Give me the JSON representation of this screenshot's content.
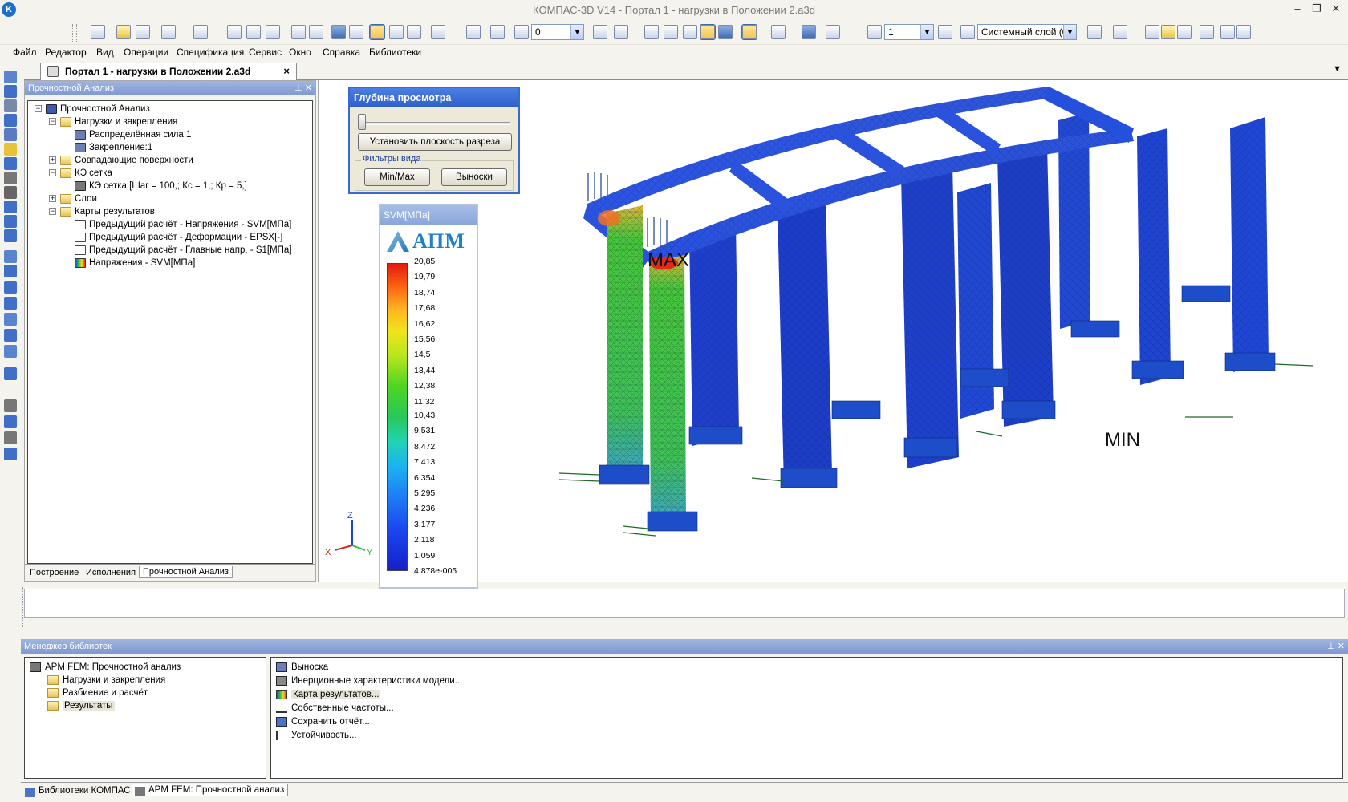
{
  "window": {
    "title": "КОМПАС-3D V14 - Портал 1 - нагрузки в Положении 2.a3d",
    "minimize_glyph": "–",
    "restore_glyph": "❐",
    "close_glyph": "✕"
  },
  "toolbar": {
    "zoom_value": "0",
    "step_value": "1",
    "layer_value": "Системный слой (0;"
  },
  "menu": [
    "Файл",
    "Редактор",
    "Вид",
    "Операции",
    "Спецификация",
    "Сервис",
    "Окно",
    "Справка",
    "Библиотеки"
  ],
  "doc_tab": {
    "label": "Портал 1 - нагрузки в Положении 2.a3d",
    "close": "×",
    "dropdown": "▼"
  },
  "tree_panel": {
    "title": "Прочностной Анализ",
    "pins": "⊥ ✕",
    "items": [
      {
        "label": "Прочностной Анализ",
        "expander": "−"
      },
      {
        "label": "Нагрузки и закрепления",
        "expander": "−"
      },
      {
        "label": "Распределённая сила:1",
        "expander": ""
      },
      {
        "label": "Закрепление:1",
        "expander": ""
      },
      {
        "label": "Совпадающие поверхности",
        "expander": "+"
      },
      {
        "label": "КЭ сетка",
        "expander": "−"
      },
      {
        "label": "КЭ сетка [Шаг = 100,; Кс = 1,; Кр = 5,]",
        "expander": ""
      },
      {
        "label": "Слои",
        "expander": "+"
      },
      {
        "label": "Карты результатов",
        "expander": "−"
      },
      {
        "label": "Предыдущий расчёт - Напряжения - SVM[МПа]",
        "expander": ""
      },
      {
        "label": "Предыдущий расчёт - Деформации - EPSX[-]",
        "expander": ""
      },
      {
        "label": "Предыдущий расчёт - Главные напр. - S1[МПа]",
        "expander": ""
      },
      {
        "label": "Напряжения - SVM[МПа]",
        "expander": ""
      }
    ],
    "tabs": [
      "Построение",
      "Исполнения",
      "Прочностной Анализ"
    ]
  },
  "depth_dialog": {
    "title": "Глубина просмотра",
    "set_plane_button": "Установить плоскость разреза",
    "filters_label": "Фильтры вида",
    "minmax_button": "Min/Max",
    "callouts_button": "Выноски"
  },
  "legend": {
    "title": "SVM[МПа]",
    "logo_text": "АПМ",
    "values": [
      "20,85",
      "19,79",
      "18,74",
      "17,68",
      "16,62",
      "15,56",
      "14,5",
      "13,44",
      "12,38",
      "11,32",
      "10,43",
      "9,531",
      "8,472",
      "7,413",
      "6,354",
      "5,295",
      "4,236",
      "3,177",
      "2,118",
      "1,059",
      "4,878e-005"
    ]
  },
  "viewport": {
    "max_label": "MAX",
    "min_label": "MIN",
    "axis_x": "X",
    "axis_y": "Y",
    "axis_z": "Z"
  },
  "library_manager": {
    "title": "Менеджер библиотек",
    "pins": "⊥ ✕",
    "tree": [
      {
        "label": "APM FEM: Прочностной анализ"
      },
      {
        "label": "Нагрузки и закрепления"
      },
      {
        "label": "Разбиение и расчёт"
      },
      {
        "label": "Результаты"
      }
    ],
    "commands": [
      {
        "label": "Выноска"
      },
      {
        "label": "Инерционные характеристики модели..."
      },
      {
        "label": "Карта результатов..."
      },
      {
        "label": "Собственные частоты..."
      },
      {
        "label": "Сохранить отчёт..."
      },
      {
        "label": "Устойчивость..."
      }
    ],
    "tabs": [
      "Библиотеки КОМПАС",
      "APM FEM: Прочностной анализ"
    ]
  }
}
